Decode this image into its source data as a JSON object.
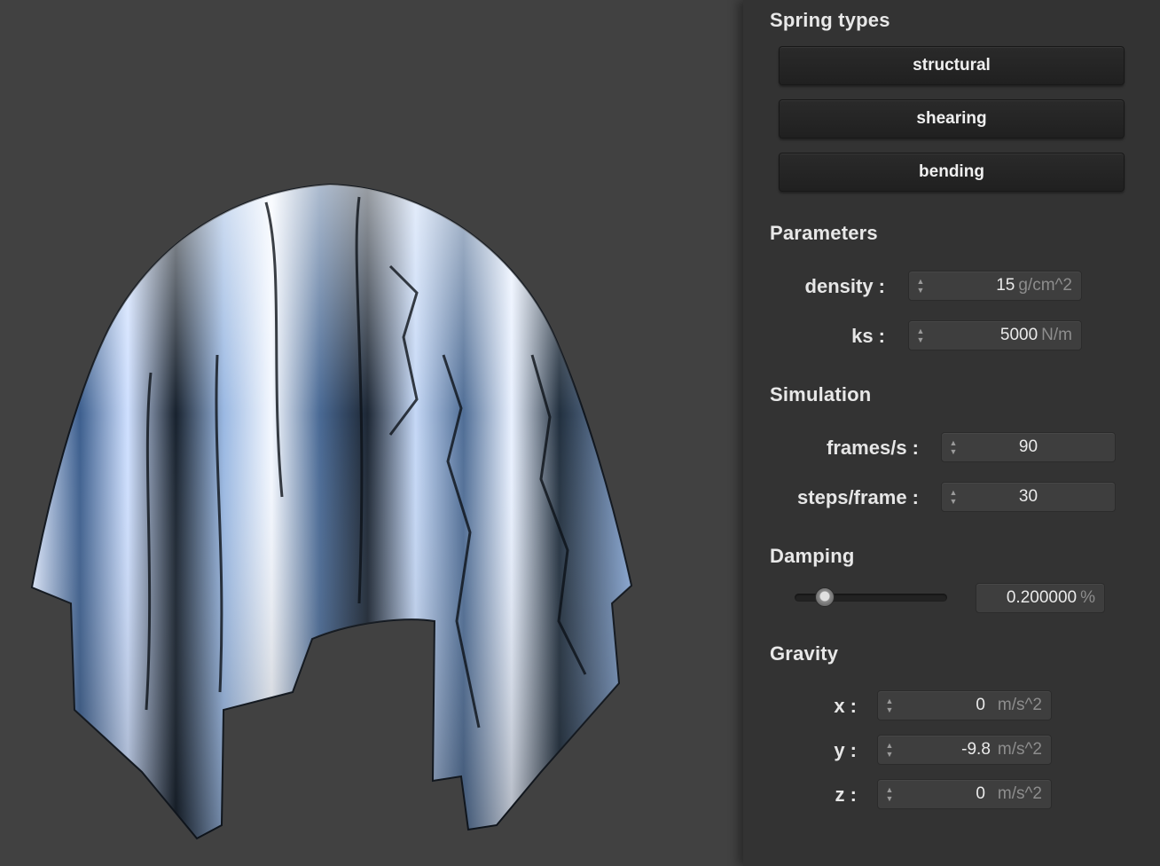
{
  "panel": {
    "spring_types": {
      "title": "Spring types",
      "buttons": [
        "structural",
        "shearing",
        "bending"
      ]
    },
    "parameters": {
      "title": "Parameters",
      "density": {
        "label": "density :",
        "value": "15",
        "unit": "g/cm^2"
      },
      "ks": {
        "label": "ks :",
        "value": "5000",
        "unit": "N/m"
      }
    },
    "simulation": {
      "title": "Simulation",
      "frames": {
        "label": "frames/s :",
        "value": "90"
      },
      "steps": {
        "label": "steps/frame :",
        "value": "30"
      }
    },
    "damping": {
      "title": "Damping",
      "value": "0.200000",
      "unit": "%",
      "slider_fraction": 0.2
    },
    "gravity": {
      "title": "Gravity",
      "x": {
        "label": "x :",
        "value": "0",
        "unit": "m/s^2"
      },
      "y": {
        "label": "y :",
        "value": "-9.8",
        "unit": "m/s^2"
      },
      "z": {
        "label": "z :",
        "value": "0",
        "unit": "m/s^2"
      }
    }
  },
  "spinner_icon": "up-down-arrows",
  "colors": {
    "panel_bg": "#333333",
    "viewport_bg": "#414141",
    "cloth_highlight": "#cfe2ff",
    "cloth_shadow": "#1a2230"
  }
}
